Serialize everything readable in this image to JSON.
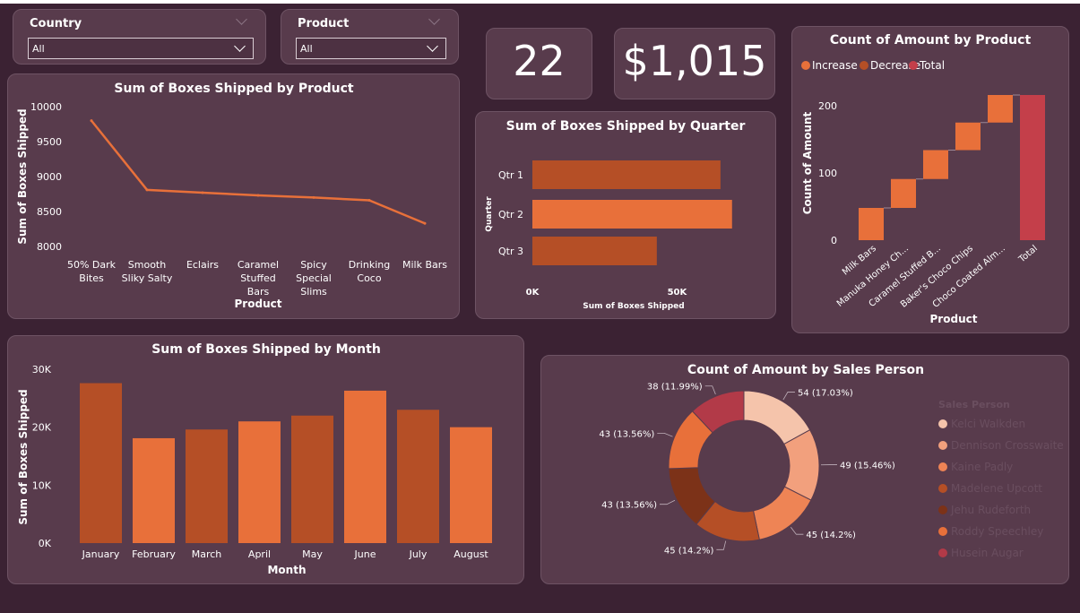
{
  "filters": [
    {
      "label": "Country",
      "value": "All"
    },
    {
      "label": "Product",
      "value": "All"
    }
  ],
  "kpis": {
    "count": "22",
    "amount": "$1,015"
  },
  "chart_data": [
    {
      "type": "line",
      "title": "Sum of Boxes Shipped by Product",
      "xlabel": "Product",
      "ylabel": "Sum of Boxes Shipped",
      "categories": [
        "50% Dark Bites",
        "Smooth Sliky Salty",
        "Eclairs",
        "Caramel Stuffed Bars",
        "Spicy Special Slims",
        "Drinking Coco",
        "Milk Bars"
      ],
      "values": [
        9800,
        8810,
        8770,
        8730,
        8700,
        8660,
        8330
      ],
      "ylim": [
        8000,
        10000
      ],
      "yticks": [
        10000,
        9500,
        9000,
        8500,
        8000
      ],
      "color": "#e8703a"
    },
    {
      "type": "bar",
      "orientation": "horizontal",
      "title": "Sum of Boxes Shipped by Quarter",
      "xlabel": "Sum of Boxes Shipped",
      "ylabel": "Quarter",
      "categories": [
        "Qtr 1",
        "Qtr 2",
        "Qtr 3"
      ],
      "values": [
        65000,
        69000,
        43000
      ],
      "xlim": [
        0,
        70000
      ],
      "xticks": [
        "0K",
        "50K"
      ],
      "colors": [
        "#b54f26",
        "#e8703a",
        "#b54f26"
      ]
    },
    {
      "type": "waterfall",
      "title": "Count of Amount by Product",
      "xlabel": "Product",
      "ylabel": "Count of Amount",
      "legend": [
        "Increase",
        "Decrease",
        "Total"
      ],
      "legend_colors": [
        "#e8703a",
        "#b54f26",
        "#c43f4a"
      ],
      "categories": [
        "Milk Bars",
        "Manuka Honey Ch...",
        "Caramel Stuffed B...",
        "Baker's Choco Chips",
        "Choco Coated Alm...",
        "Total"
      ],
      "values": [
        48,
        43,
        43,
        41,
        41,
        216
      ],
      "ylim": [
        0,
        240
      ],
      "yticks": [
        "200",
        "100",
        "0"
      ]
    },
    {
      "type": "bar",
      "title": "Sum of Boxes Shipped by Month",
      "xlabel": "Month",
      "ylabel": "Sum of Boxes Shipped",
      "categories": [
        "January",
        "February",
        "March",
        "April",
        "May",
        "June",
        "July",
        "August"
      ],
      "values": [
        27600,
        18100,
        19600,
        21000,
        22000,
        26300,
        23000,
        20000
      ],
      "ylim": [
        0,
        30000
      ],
      "yticks": [
        "30K",
        "20K",
        "10K",
        "0K"
      ],
      "colors": [
        "#b54f26",
        "#e8703a",
        "#b54f26",
        "#e8703a",
        "#b54f26",
        "#e8703a",
        "#b54f26",
        "#e8703a"
      ]
    },
    {
      "type": "pie",
      "style": "donut",
      "title": "Count of Amount by Sales Person",
      "legend_title": "Sales Person",
      "slices": [
        {
          "name": "Kelci Walkden",
          "value": 54,
          "label": "54 (17.03%)",
          "color": "#f5c4ab"
        },
        {
          "name": "Dennison Crosswaite",
          "value": 49,
          "label": "49 (15.46%)",
          "color": "#f2a07d"
        },
        {
          "name": "Kaine Padly",
          "value": 45,
          "label": "45 (14.2%)",
          "color": "#ee8455"
        },
        {
          "name": "Madelene Upcott",
          "value": 45,
          "label": "45 (14.2%)",
          "color": "#b54f26"
        },
        {
          "name": "Jehu Rudeforth",
          "value": 43,
          "label": "43 (13.56%)",
          "color": "#7c3218"
        },
        {
          "name": "Roddy Speechley",
          "value": 43,
          "label": "43 (13.56%)",
          "color": "#e8703a"
        },
        {
          "name": "Husein Augar",
          "value": 38,
          "label": "38 (11.99%)",
          "color": "#b23a48"
        }
      ]
    }
  ]
}
